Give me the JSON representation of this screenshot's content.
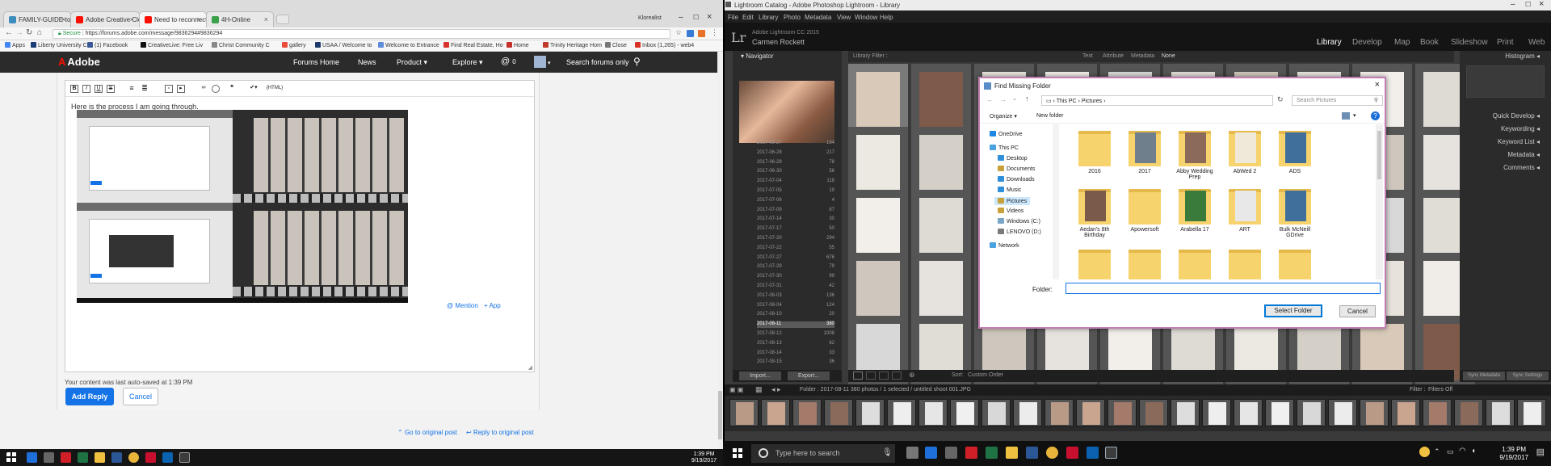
{
  "left_screen": {
    "tabs": [
      {
        "title": "FAMILY-GUIDE-to-the-",
        "icon_color": "#3c8dbc"
      },
      {
        "title": "Adobe Creative Cloud L",
        "icon_color": "#fa0f00"
      },
      {
        "title": "Need to reconnect edit",
        "icon_color": "#fa0f00"
      },
      {
        "title": "4H-Online",
        "icon_color": "#3aa04a"
      }
    ],
    "window_user": "Klorealist",
    "url_secure": "Secure",
    "url": "https://forums.adobe.com/message/9836294#9836294",
    "bookmarks": [
      {
        "label": "Apps",
        "color": "#4285f4"
      },
      {
        "label": "Liberty University Ch",
        "color": "#1d3b75"
      },
      {
        "label": "(1) Facebook",
        "color": "#3b5998"
      },
      {
        "label": "CreativeLive: Free Liv",
        "color": "#111111"
      },
      {
        "label": "Christ Community C",
        "color": "#888888"
      },
      {
        "label": "gallery",
        "color": "#e94c3c"
      },
      {
        "label": "USAA / Welcome to",
        "color": "#1c3b6c"
      },
      {
        "label": "Welcome to Entrance",
        "color": "#5e8cd9"
      },
      {
        "label": "Find Real Estate, Ho",
        "color": "#d6342a"
      },
      {
        "label": "Home",
        "color": "#c4302b"
      },
      {
        "label": "Trinity Heritage Hom",
        "color": "#c0392b"
      },
      {
        "label": "Close",
        "color": "#777777"
      },
      {
        "label": "Inbox (1,265) - web4",
        "color": "#d93025"
      }
    ],
    "header": {
      "logo": "Adobe",
      "nav": [
        "Forums Home",
        "News",
        "Product",
        "Explore"
      ],
      "notifications": "0",
      "search_label": "Search forums only"
    },
    "editor": {
      "html_btn": "{HTML}",
      "body_text": "Here is the process I am going through.",
      "mention": "Mention",
      "attach": "App"
    },
    "autosave": "Your content was last auto-saved at 1:39 PM",
    "add_reply": "Add Reply",
    "cancel": "Cancel",
    "go_original": "Go to original post",
    "reply_original": "Reply to original post",
    "clock_time": "1:39 PM",
    "clock_date": "9/19/2017"
  },
  "lightroom": {
    "title": "Lightroom Catalog - Adobe Photoshop Lightroom - Library",
    "menu": [
      "File",
      "Edit",
      "Library",
      "Photo",
      "Metadata",
      "View",
      "Window",
      "Help"
    ],
    "version": "Adobe Lightroom CC 2015",
    "user": "Carmen Rockett",
    "modules": [
      "Library",
      "Develop",
      "Map",
      "Book",
      "Slideshow",
      "Print",
      "Web"
    ],
    "active_module": "Library",
    "navigator": "Navigator",
    "library_filter": "Library Filter :",
    "filter_tabs": [
      "Text",
      "Attribute",
      "Metadata",
      "None"
    ],
    "folders": [
      {
        "name": "2017-06-27",
        "count": "184"
      },
      {
        "name": "2017-06-28",
        "count": "217"
      },
      {
        "name": "2017-06-29",
        "count": "78"
      },
      {
        "name": "2017-06-30",
        "count": "56"
      },
      {
        "name": "2017-07-04",
        "count": "118"
      },
      {
        "name": "2017-07-05",
        "count": "19"
      },
      {
        "name": "2017-07-06",
        "count": "4"
      },
      {
        "name": "2017-07-09",
        "count": "87"
      },
      {
        "name": "2017-07-14",
        "count": "30"
      },
      {
        "name": "2017-07-17",
        "count": "50"
      },
      {
        "name": "2017-07-20",
        "count": "294"
      },
      {
        "name": "2017-07-22",
        "count": "55"
      },
      {
        "name": "2017-07-27",
        "count": "676"
      },
      {
        "name": "2017-07-29",
        "count": "79"
      },
      {
        "name": "2017-07-30",
        "count": "99"
      },
      {
        "name": "2017-07-31",
        "count": "42"
      },
      {
        "name": "2017-08-03",
        "count": "136"
      },
      {
        "name": "2017-08-04",
        "count": "124"
      },
      {
        "name": "2017-08-10",
        "count": "20"
      },
      {
        "name": "2017-08-11",
        "count": "380"
      },
      {
        "name": "2017-08-12",
        "count": "1008"
      },
      {
        "name": "2017-08-13",
        "count": "62"
      },
      {
        "name": "2017-08-14",
        "count": "33"
      },
      {
        "name": "2017-08-15",
        "count": "36"
      }
    ],
    "import_btn": "Import...",
    "export_btn": "Export...",
    "sort_label": "Sort:",
    "sort_value": "Custom Order",
    "right_panels": [
      "Histogram",
      "Quick Develop",
      "Keywording",
      "Keyword List",
      "Metadata",
      "Comments"
    ],
    "sync_metadata": "Sync Metadata",
    "sync_settings": "Sync Settings",
    "filmstrip_info": "Folder : 2017-08-11     380 photos / 1 selected / untitled shoot 001.JPG",
    "filter_label": "Filter :",
    "filter_value": "Filters Off",
    "grid_numbers": [
      "6",
      "7",
      "8",
      "9",
      "10",
      "11",
      "12",
      "13",
      "14",
      "15",
      "16",
      "17"
    ]
  },
  "dialog": {
    "title": "Find Missing Folder",
    "path": [
      "This PC",
      "Pictures"
    ],
    "search_placeholder": "Search Pictures",
    "organize": "Organize",
    "new_folder": "New folder",
    "tree": [
      {
        "label": "OneDrive",
        "color": "#1e88e5"
      },
      {
        "label": "This PC",
        "color": "#4aa3df"
      },
      {
        "label": "Desktop",
        "color": "#2f8fd8"
      },
      {
        "label": "Documents",
        "color": "#c9a13a"
      },
      {
        "label": "Downloads",
        "color": "#2f8fd8"
      },
      {
        "label": "Music",
        "color": "#2f8fd8"
      },
      {
        "label": "Pictures",
        "color": "#c9a13a"
      },
      {
        "label": "Videos",
        "color": "#c9a13a"
      },
      {
        "label": "Windows (C:)",
        "color": "#7aa6c8"
      },
      {
        "label": "LENOVO (D:)",
        "color": "#7a7a7a"
      },
      {
        "label": "Network",
        "color": "#4aa3df"
      }
    ],
    "selected_tree": "Pictures",
    "folders": [
      {
        "name": "2016",
        "thumb": ""
      },
      {
        "name": "2017",
        "thumb": "#6f7f8c"
      },
      {
        "name": "Abby Wedding Prep",
        "thumb": "#8c6a5a"
      },
      {
        "name": "AbWed 2",
        "thumb": "#f0e8d8"
      },
      {
        "name": "ADS",
        "thumb": "#3f6f9a"
      },
      {
        "name": "Aedan's 8th Birthday",
        "thumb": "#7a5a4a"
      },
      {
        "name": "Apowersoft",
        "thumb": ""
      },
      {
        "name": "Arabella 17",
        "thumb": "#3a7a3a"
      },
      {
        "name": "ART",
        "thumb": "#e8e8e8"
      },
      {
        "name": "Bulk McNeill GDrive",
        "thumb": "#3f6f9a"
      }
    ],
    "folder_label": "Folder:",
    "select_folder": "Select Folder",
    "cancel": "Cancel"
  },
  "right_taskbar": {
    "search_placeholder": "Type here to search",
    "clock_time": "1:39 PM",
    "clock_date": "9/19/2017"
  }
}
